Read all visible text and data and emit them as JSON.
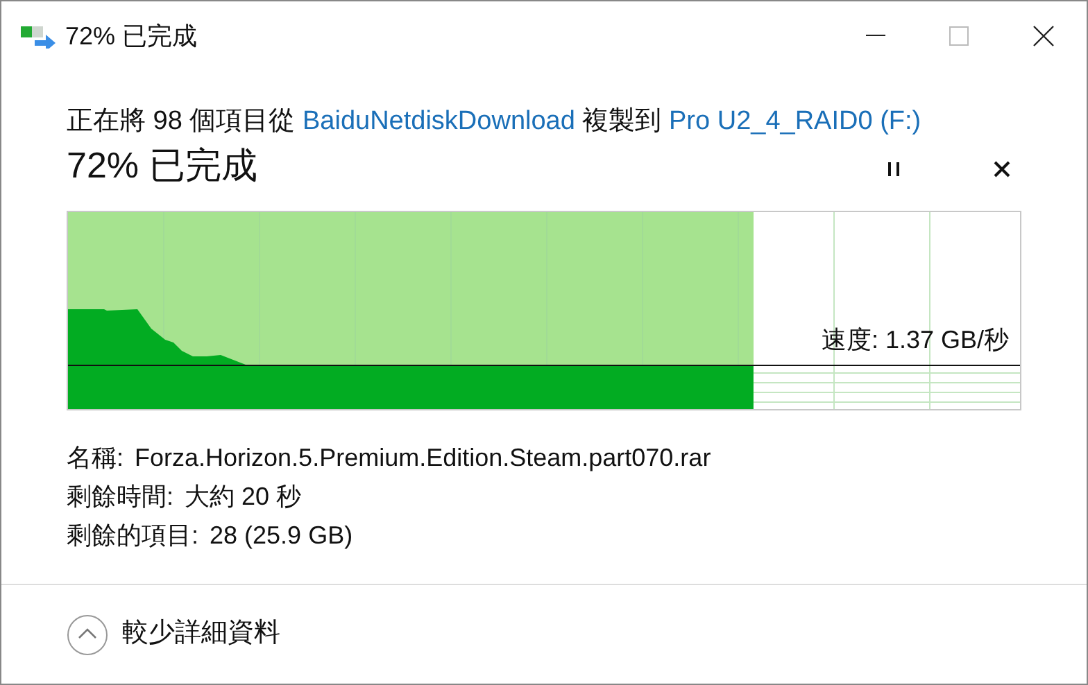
{
  "window": {
    "title": "72% 已完成"
  },
  "header": {
    "parts": [
      {
        "kind": "text",
        "text": "正在將 98 個項目從"
      },
      {
        "kind": "link",
        "text": "BaiduNetdiskDownload"
      },
      {
        "kind": "text",
        "text": "複製到"
      },
      {
        "kind": "link",
        "text": "Pro U2_4_RAID0 (F:)"
      }
    ]
  },
  "progress": {
    "title": "72% 已完成",
    "level": 0.72,
    "speed": "速度: 1.37 GB/秒"
  },
  "details": [
    {
      "label": "名稱:",
      "value": "Forza.Horizon.5.Premium.Edition.Steam.part070.rar"
    },
    {
      "label": "剩餘時間:",
      "value": "大約 20 秒"
    },
    {
      "label": "剩餘的項目:",
      "value": "28 (25.9 GB)"
    }
  ],
  "footer": {
    "label": "較少詳細資料",
    "expanded": true
  }
}
